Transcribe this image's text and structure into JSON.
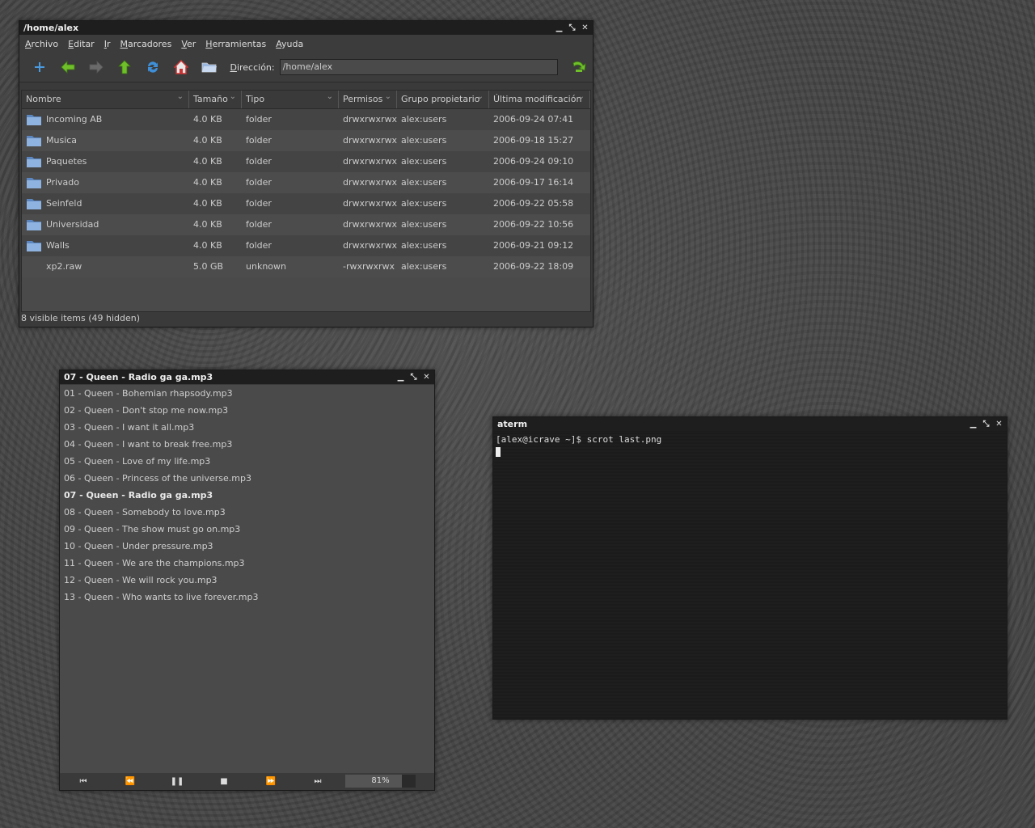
{
  "file_manager": {
    "title": "/home/alex",
    "menu": [
      "Archivo",
      "Editar",
      "Ir",
      "Marcadores",
      "Ver",
      "Herramientas",
      "Ayuda"
    ],
    "address_label": "Dirección:",
    "address_value": "/home/alex",
    "columns": [
      "Nombre",
      "Tamaño",
      "Tipo",
      "Permisos",
      "Grupo propietario",
      "Última modificación"
    ],
    "rows": [
      {
        "name": "Incoming AB",
        "size": "4.0 KB",
        "type": "folder",
        "perms": "drwxrwxrwx",
        "group": "alex:users",
        "modified": "2006-09-24 07:41",
        "icon": "folder-icon"
      },
      {
        "name": "Musica",
        "size": "4.0 KB",
        "type": "folder",
        "perms": "drwxrwxrwx",
        "group": "alex:users",
        "modified": "2006-09-18 15:27",
        "icon": "folder-icon"
      },
      {
        "name": "Paquetes",
        "size": "4.0 KB",
        "type": "folder",
        "perms": "drwxrwxrwx",
        "group": "alex:users",
        "modified": "2006-09-24 09:10",
        "icon": "folder-icon"
      },
      {
        "name": "Privado",
        "size": "4.0 KB",
        "type": "folder",
        "perms": "drwxrwxrwx",
        "group": "alex:users",
        "modified": "2006-09-17 16:14",
        "icon": "folder-icon"
      },
      {
        "name": "Seinfeld",
        "size": "4.0 KB",
        "type": "folder",
        "perms": "drwxrwxrwx",
        "group": "alex:users",
        "modified": "2006-09-22 05:58",
        "icon": "folder-icon"
      },
      {
        "name": "Universidad",
        "size": "4.0 KB",
        "type": "folder",
        "perms": "drwxrwxrwx",
        "group": "alex:users",
        "modified": "2006-09-22 10:56",
        "icon": "folder-icon"
      },
      {
        "name": "Walls",
        "size": "4.0 KB",
        "type": "folder",
        "perms": "drwxrwxrwx",
        "group": "alex:users",
        "modified": "2006-09-21 09:12",
        "icon": "folder-icon"
      },
      {
        "name": "xp2.raw",
        "size": "5.0 GB",
        "type": "unknown",
        "perms": "-rwxrwxrwx",
        "group": "alex:users",
        "modified": "2006-09-22 18:09",
        "icon": ""
      }
    ],
    "status": "8 visible items (49 hidden)"
  },
  "player": {
    "title": "07 - Queen - Radio ga ga.mp3",
    "tracks": [
      "01 - Queen - Bohemian rhapsody.mp3",
      "02 - Queen - Don't stop me now.mp3",
      "03 - Queen - I want it all.mp3",
      "04 - Queen - I want to break free.mp3",
      "05 - Queen - Love of my life.mp3",
      "06 - Queen - Princess of the universe.mp3",
      "07 - Queen - Radio ga ga.mp3",
      "08 - Queen - Somebody to love.mp3",
      "09 - Queen - The show must go on.mp3",
      "10 - Queen - Under pressure.mp3",
      "11 - Queen - We are the champions.mp3",
      "12 - Queen - We will rock you.mp3",
      "13 - Queen - Who wants to live forever.mp3"
    ],
    "current_index": 6,
    "volume": "81%",
    "controls": [
      "skip-back-icon",
      "rewind-icon",
      "pause-icon",
      "stop-icon",
      "fast-forward-icon",
      "skip-forward-icon"
    ]
  },
  "terminal": {
    "title": "aterm",
    "line": "[alex@icrave ~]$ scrot last.png"
  },
  "colors": {
    "titlebar": "#1e1e1e",
    "window": "#3a3a3a",
    "list": "#4a4a4a",
    "icon_green": "#6fbf2a",
    "icon_blue": "#3f8fd8",
    "folder_blue": "#7fa8d8"
  }
}
